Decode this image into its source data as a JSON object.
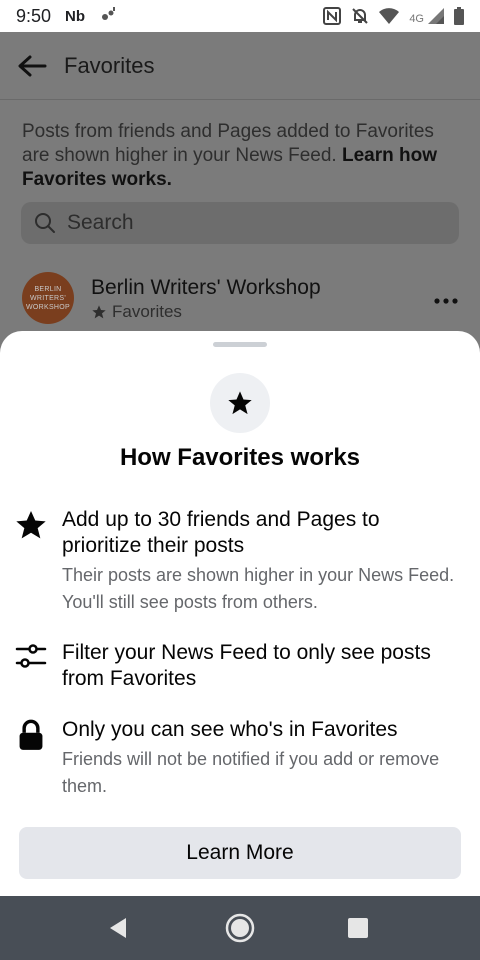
{
  "status_bar": {
    "time": "9:50",
    "carrier": "Nb",
    "network": "4G"
  },
  "header": {
    "title": "Favorites"
  },
  "intro": {
    "text": "Posts from friends and Pages added to Favorites are shown higher in your News Feed. ",
    "link": "Learn how Favorites works."
  },
  "search": {
    "placeholder": "Search"
  },
  "favorites_list": [
    {
      "name": "Berlin Writers' Workshop",
      "subtitle": "Favorites",
      "avatar_lines": [
        "BERLIN",
        "WRITERS'",
        "WORKSHOP"
      ],
      "avatar_color": "#7a3e1e"
    }
  ],
  "sheet": {
    "title": "How Favorites works",
    "items": [
      {
        "icon": "star-icon",
        "title": "Add up to 30 friends and Pages to prioritize their posts",
        "description": "Their posts are shown higher in your News Feed. You'll still see posts from others."
      },
      {
        "icon": "filter-icon",
        "title": "Filter your News Feed to only see posts from Favorites",
        "description": ""
      },
      {
        "icon": "lock-icon",
        "title": "Only you can see who's in Favorites",
        "description": "Friends will not be notified if you add or remove them."
      }
    ],
    "button_label": "Learn More"
  },
  "colors": {
    "sheet_background": "#ffffff",
    "button_background": "#e4e6eb",
    "secondary_text": "#65676b",
    "nav_bar": "#484e56"
  }
}
